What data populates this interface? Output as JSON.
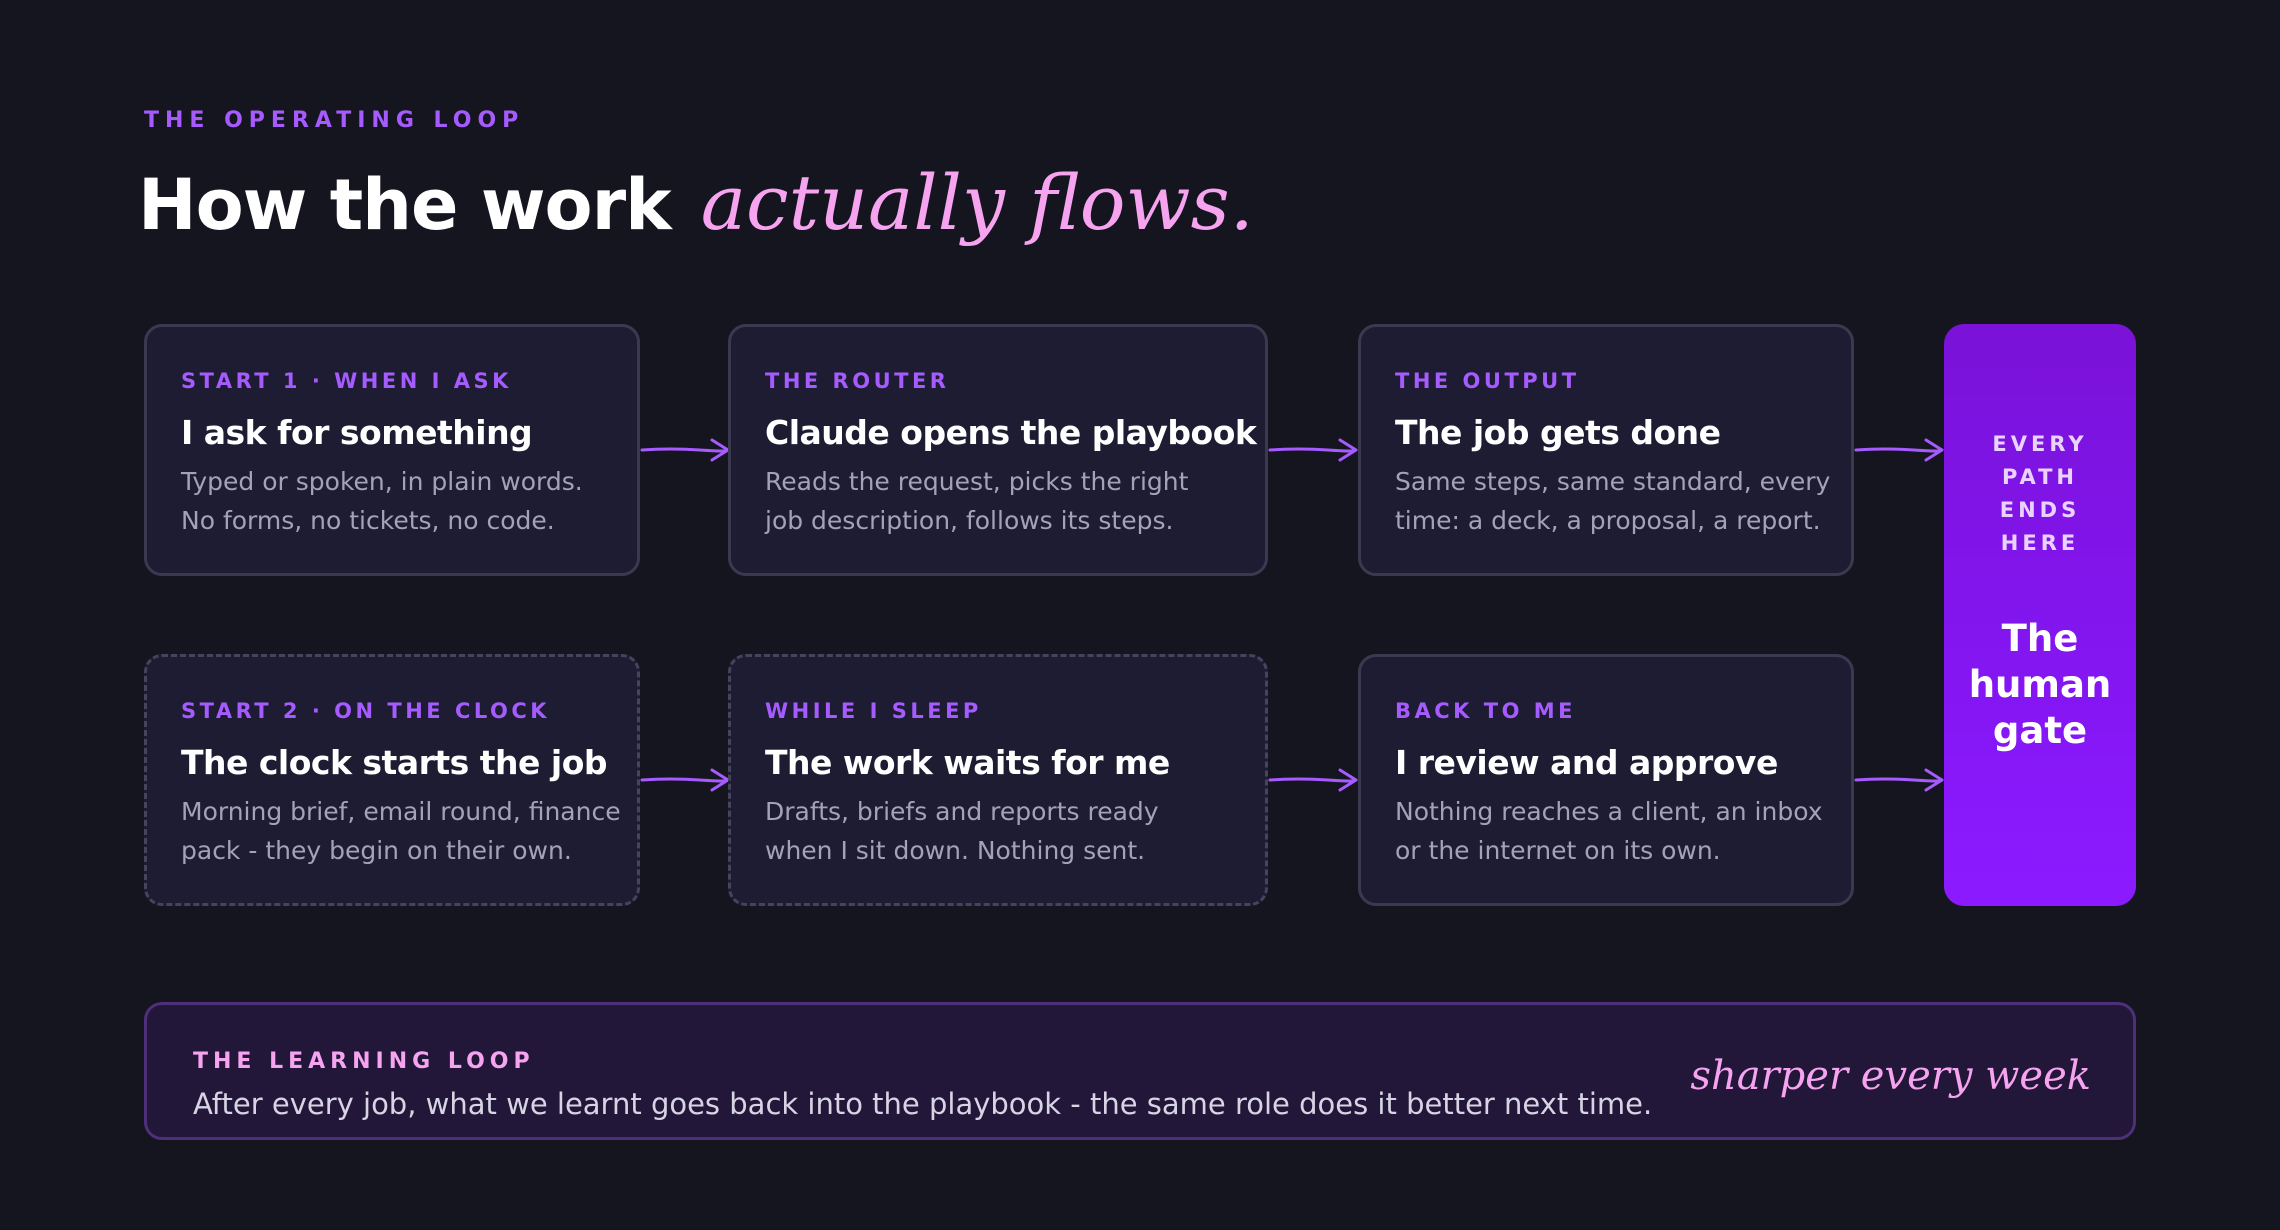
{
  "header": {
    "eyebrow": "THE OPERATING LOOP",
    "title_plain": "How the work",
    "title_script": "actually flows."
  },
  "rows": [
    {
      "cards": [
        {
          "kicker": "START 1 · WHEN I ASK",
          "title": "I ask for something",
          "body": [
            "Typed or spoken, in plain words.",
            "No forms, no tickets, no code."
          ]
        },
        {
          "kicker": "THE ROUTER",
          "title": "Claude opens the playbook",
          "body": [
            "Reads the request, picks the right",
            "job description, follows its steps."
          ]
        },
        {
          "kicker": "THE OUTPUT",
          "title": "The job gets done",
          "body": [
            "Same steps, same standard, every",
            "time: a deck, a proposal, a report."
          ]
        }
      ]
    },
    {
      "cards": [
        {
          "kicker": "START 2 · ON THE CLOCK",
          "title": "The clock starts the job",
          "body": [
            "Morning brief, email round, finance",
            "pack - they begin on their own."
          ]
        },
        {
          "kicker": "WHILE I SLEEP",
          "title": "The work waits for me",
          "body": [
            "Drafts, briefs and reports ready",
            "when I sit down. Nothing sent."
          ]
        },
        {
          "kicker": "BACK TO ME",
          "title": "I review and approve",
          "body": [
            "Nothing reaches a client, an inbox",
            "or the internet on its own."
          ]
        }
      ]
    }
  ],
  "gate": {
    "kicker": [
      "EVERY",
      "PATH",
      "ENDS",
      "HERE"
    ],
    "title": [
      "The",
      "human",
      "gate"
    ]
  },
  "learning": {
    "kicker": "THE LEARNING LOOP",
    "body": "After every job, what we learnt goes back into the playbook - the same role does it better next time.",
    "note": "sharper every week"
  },
  "colors": {
    "background": "#15151f",
    "card": "#1d1c33",
    "accent_purple": "#a65bff",
    "accent_pink": "#f6a3f0",
    "gate": "#8416f2"
  }
}
